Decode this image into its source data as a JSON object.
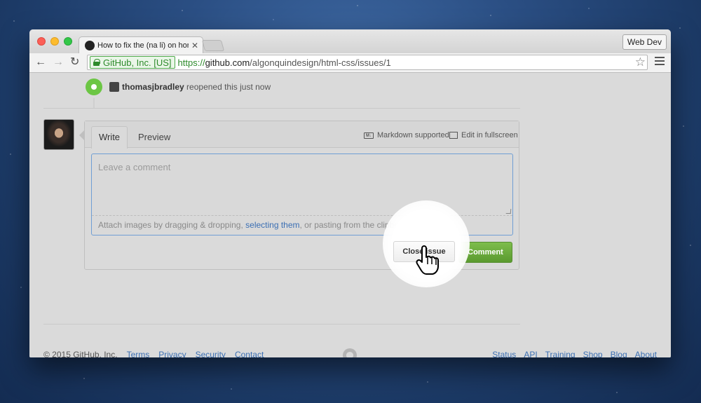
{
  "browser": {
    "tab_title": "How to fix the (na li) on hor",
    "profile_label": "Web Dev",
    "ev_badge": "GitHub, Inc. [US]",
    "url_scheme": "https://",
    "url_host": "github.com",
    "url_path": "/algonquindesign/html-css/issues/1"
  },
  "timeline": {
    "user": "thomasjbradley",
    "action": "reopened this just now"
  },
  "comment": {
    "tab_write": "Write",
    "tab_preview": "Preview",
    "markdown_icon": "M↓",
    "markdown_label": "Markdown supported",
    "fullscreen_label": "Edit in fullscreen",
    "placeholder": "Leave a comment",
    "attach_prefix": "Attach images by dragging & dropping, ",
    "attach_link": "selecting them",
    "attach_suffix": ", or pasting from the clipboard.",
    "close_button": "Close issue",
    "comment_button": "Comment"
  },
  "footer": {
    "copyright": "© 2015 GitHub, Inc.",
    "left_links": [
      "Terms",
      "Privacy",
      "Security",
      "Contact"
    ],
    "right_links": [
      "Status",
      "API",
      "Training",
      "Shop",
      "Blog",
      "About"
    ]
  },
  "icons": {
    "back": "arrow-left-icon",
    "forward": "arrow-right-icon",
    "reload": "reload-icon",
    "bookmark": "star-icon",
    "menu": "hamburger-icon",
    "pointer": "hand-pointer-icon"
  },
  "colors": {
    "accent_green": "#6cc644",
    "link_blue": "#3b6fb3",
    "ev_green": "#2d8a2b"
  }
}
